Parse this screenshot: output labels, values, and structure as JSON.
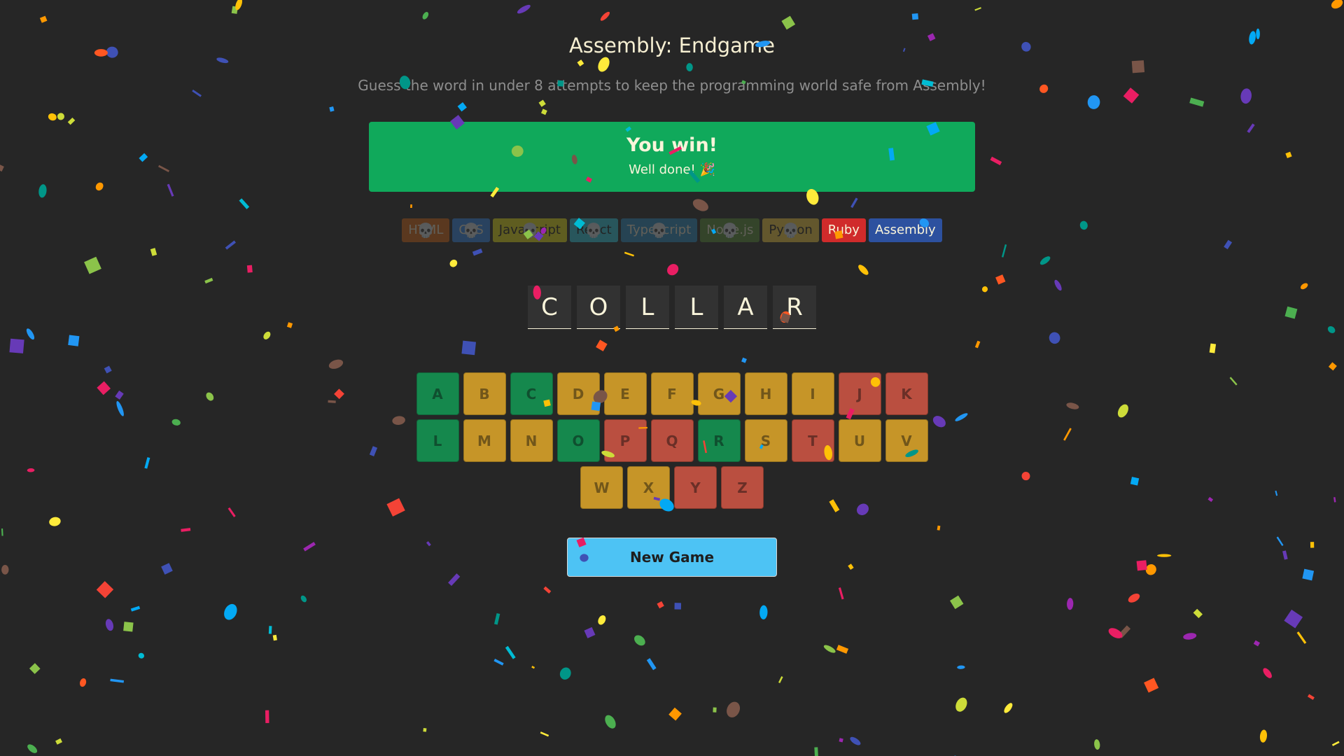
{
  "header": {
    "title": "Assembly: Endgame",
    "subtitle": "Guess the word in under 8 attempts to keep the programming world safe from Assembly!"
  },
  "status": {
    "title": "You win!",
    "message": "Well done! 🎉",
    "color": "#10A95B"
  },
  "languages": [
    {
      "name": "HTML",
      "bg": "#E2680F",
      "fg": "#F9F4DA",
      "lost": true
    },
    {
      "name": "CSS",
      "bg": "#328AF1",
      "fg": "#F9F4DA",
      "lost": true
    },
    {
      "name": "Javascript",
      "bg": "#F4EB13",
      "fg": "#1E1E1E",
      "lost": true
    },
    {
      "name": "React",
      "bg": "#2ED3E9",
      "fg": "#1E1E1E",
      "lost": true
    },
    {
      "name": "Typescript",
      "bg": "#298EC6",
      "fg": "#F9F4DA",
      "lost": true
    },
    {
      "name": "Node.js",
      "bg": "#599137",
      "fg": "#F9F4DA",
      "lost": true
    },
    {
      "name": "Python",
      "bg": "#FFD742",
      "fg": "#1E1E1E",
      "lost": true
    },
    {
      "name": "Ruby",
      "bg": "#D02B2B",
      "fg": "#F9F4DA",
      "lost": false
    },
    {
      "name": "Assembly",
      "bg": "#2D519F",
      "fg": "#F9F4DA",
      "lost": false
    }
  ],
  "lost_marker": "💀",
  "word": [
    "C",
    "O",
    "L",
    "L",
    "A",
    "R"
  ],
  "keyboard": [
    {
      "letter": "A",
      "state": "correct"
    },
    {
      "letter": "B",
      "state": "unused"
    },
    {
      "letter": "C",
      "state": "correct"
    },
    {
      "letter": "D",
      "state": "unused"
    },
    {
      "letter": "E",
      "state": "unused"
    },
    {
      "letter": "F",
      "state": "unused"
    },
    {
      "letter": "G",
      "state": "unused"
    },
    {
      "letter": "H",
      "state": "unused"
    },
    {
      "letter": "I",
      "state": "unused"
    },
    {
      "letter": "J",
      "state": "wrong"
    },
    {
      "letter": "K",
      "state": "wrong"
    },
    {
      "letter": "L",
      "state": "correct"
    },
    {
      "letter": "M",
      "state": "unused"
    },
    {
      "letter": "N",
      "state": "unused"
    },
    {
      "letter": "O",
      "state": "correct"
    },
    {
      "letter": "P",
      "state": "wrong"
    },
    {
      "letter": "Q",
      "state": "wrong"
    },
    {
      "letter": "R",
      "state": "correct"
    },
    {
      "letter": "S",
      "state": "unused"
    },
    {
      "letter": "T",
      "state": "wrong"
    },
    {
      "letter": "U",
      "state": "unused"
    },
    {
      "letter": "V",
      "state": "unused"
    },
    {
      "letter": "W",
      "state": "unused"
    },
    {
      "letter": "X",
      "state": "unused"
    },
    {
      "letter": "Y",
      "state": "wrong"
    },
    {
      "letter": "Z",
      "state": "wrong"
    }
  ],
  "new_game_label": "New Game",
  "confetti_colors": [
    "#F44336",
    "#E91E63",
    "#9C27B0",
    "#673AB7",
    "#3F51B5",
    "#2196F3",
    "#03A9F4",
    "#00BCD4",
    "#009688",
    "#4CAF50",
    "#8BC34A",
    "#CDDC39",
    "#FFEB3B",
    "#FFC107",
    "#FF9800",
    "#FF5722",
    "#795548"
  ]
}
